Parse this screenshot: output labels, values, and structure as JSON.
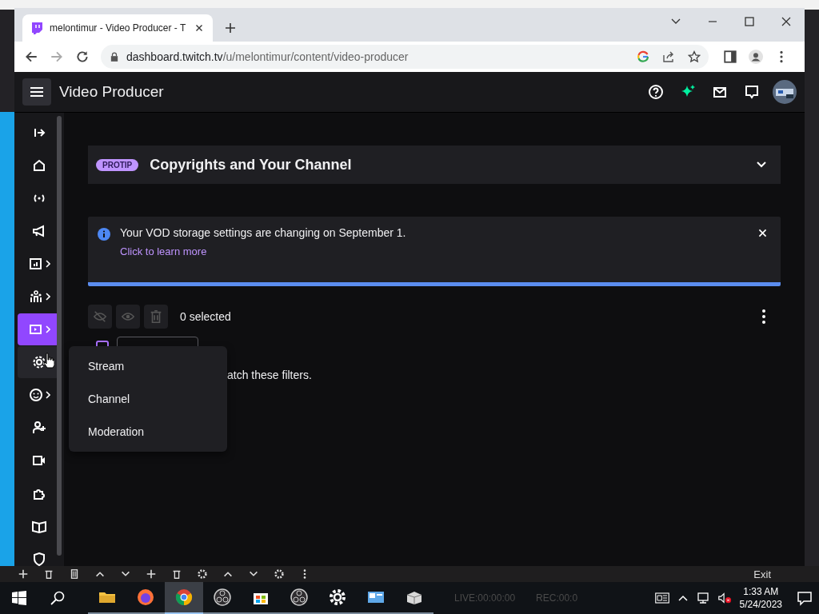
{
  "browser": {
    "tab": {
      "title": "melontimur - Video Producer - T"
    },
    "url": {
      "host": "dashboard.twitch.tv",
      "path": "/u/melontimur/content/video-producer"
    }
  },
  "header": {
    "title": "Video Producer"
  },
  "sidebar": {
    "items": [
      {
        "kind": "collapse",
        "selected": false,
        "hovered": false,
        "submenu": false
      },
      {
        "kind": "home",
        "selected": false,
        "hovered": false,
        "submenu": false
      },
      {
        "kind": "live",
        "selected": false,
        "hovered": false,
        "submenu": false
      },
      {
        "kind": "promote",
        "selected": false,
        "hovered": false,
        "submenu": false
      },
      {
        "kind": "analytics",
        "selected": false,
        "hovered": false,
        "submenu": true
      },
      {
        "kind": "community",
        "selected": false,
        "hovered": false,
        "submenu": true
      },
      {
        "kind": "content",
        "selected": true,
        "hovered": false,
        "submenu": true
      },
      {
        "kind": "settings",
        "selected": false,
        "hovered": true,
        "submenu": false
      },
      {
        "kind": "emotes",
        "selected": false,
        "hovered": false,
        "submenu": true
      },
      {
        "kind": "invite",
        "selected": false,
        "hovered": false,
        "submenu": false
      },
      {
        "kind": "camera",
        "selected": false,
        "hovered": false,
        "submenu": false
      },
      {
        "kind": "extensions",
        "selected": false,
        "hovered": false,
        "submenu": false
      },
      {
        "kind": "book",
        "selected": false,
        "hovered": false,
        "submenu": false
      },
      {
        "kind": "shield",
        "selected": false,
        "hovered": false,
        "submenu": false
      }
    ]
  },
  "protip": {
    "badge": "PROTIP",
    "title": "Copyrights and Your Channel",
    "expanded": false
  },
  "notice": {
    "message": "Your VOD storage settings are changing on September 1.",
    "link": "Click to learn more"
  },
  "toolbar": {
    "selected_count": "0 selected"
  },
  "filters": {
    "empty_message": "atch these filters."
  },
  "menu": {
    "items": [
      "Stream",
      "Channel",
      "Moderation"
    ]
  },
  "obs": {
    "exit": "Exit",
    "live": "LIVE:00:00:00",
    "rec": "REC:00:0"
  },
  "taskbar": {
    "apps": [
      {
        "kind": "folder",
        "active": false
      },
      {
        "kind": "firefox",
        "active": false
      },
      {
        "kind": "chrome",
        "active": true
      },
      {
        "kind": "obs",
        "active": false
      },
      {
        "kind": "store",
        "active": false
      },
      {
        "kind": "obs",
        "active": false
      },
      {
        "kind": "settings",
        "active": false
      },
      {
        "kind": "monitor",
        "active": false
      },
      {
        "kind": "package",
        "active": false
      }
    ],
    "time": "1:33 AM",
    "date": "5/24/2023"
  }
}
